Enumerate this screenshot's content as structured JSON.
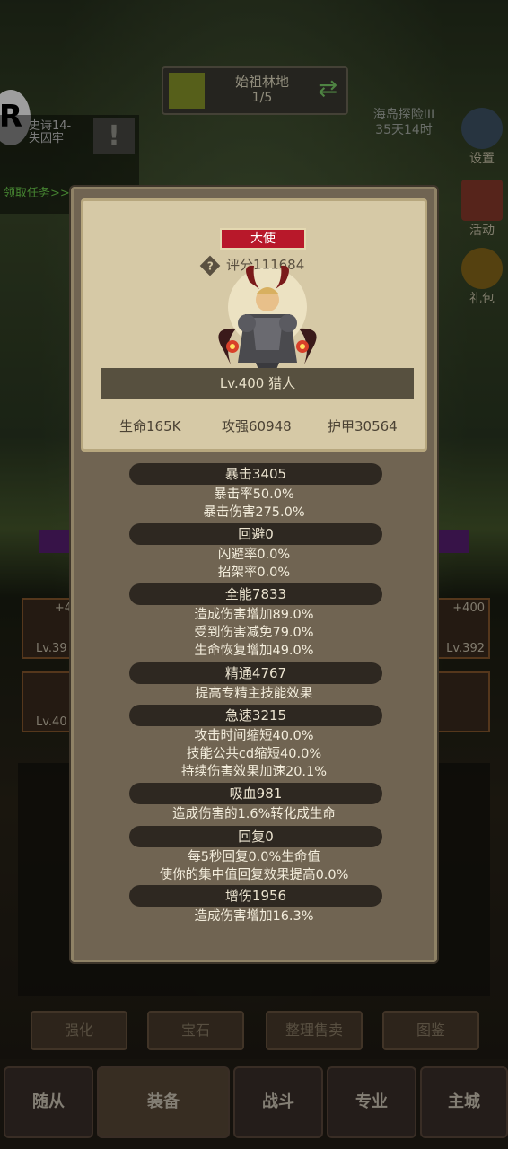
{
  "location": {
    "name": "始祖林地",
    "progress": "1/5"
  },
  "quest": {
    "text": "史诗14-\n失囚牢",
    "claim": "领取任务>>",
    "badge": "!"
  },
  "island_event": {
    "name": "海岛探险III",
    "timer": "35天14时"
  },
  "side_buttons": [
    {
      "label": "设置",
      "icon": "gear-icon"
    },
    {
      "label": "活动",
      "icon": "book-icon"
    },
    {
      "label": "礼包",
      "icon": "coin-icon"
    }
  ],
  "slots": [
    {
      "plus": "+4",
      "lv": "Lv.39"
    },
    {
      "lv": "Lv.40"
    },
    {
      "plus": "+400",
      "lv": "Lv.392"
    }
  ],
  "bottom_actions": [
    "强化",
    "宝石",
    "整理售卖",
    "图鉴"
  ],
  "tabs": [
    "随从",
    "装备",
    "战斗",
    "专业",
    "主城"
  ],
  "hero": {
    "rank": "大使",
    "score_label": "评分111684",
    "level_class": "Lv.400 猎人",
    "hp": "生命165K",
    "attack": "攻强60948",
    "armor": "护甲30564"
  },
  "attributes": [
    {
      "title": "暴击3405",
      "lines": [
        "暴击率50.0%",
        "暴击伤害275.0%"
      ]
    },
    {
      "title": "回避0",
      "lines": [
        "闪避率0.0%",
        "招架率0.0%"
      ]
    },
    {
      "title": "全能7833",
      "lines": [
        "造成伤害增加89.0%",
        "受到伤害减免79.0%",
        "生命恢复增加49.0%"
      ]
    },
    {
      "title": "精通4767",
      "lines": [
        "提高专精主技能效果"
      ]
    },
    {
      "title": "急速3215",
      "lines": [
        "攻击时间缩短40.0%",
        "技能公共cd缩短40.0%",
        "持续伤害效果加速20.1%"
      ]
    },
    {
      "title": "吸血981",
      "lines": [
        "造成伤害的1.6%转化成生命"
      ]
    },
    {
      "title": "回复0",
      "lines": [
        "每5秒回复0.0%生命值",
        "使你的集中值回复效果提高0.0%"
      ]
    },
    {
      "title": "增伤1956",
      "lines": [
        "造成伤害增加16.3%"
      ]
    }
  ]
}
